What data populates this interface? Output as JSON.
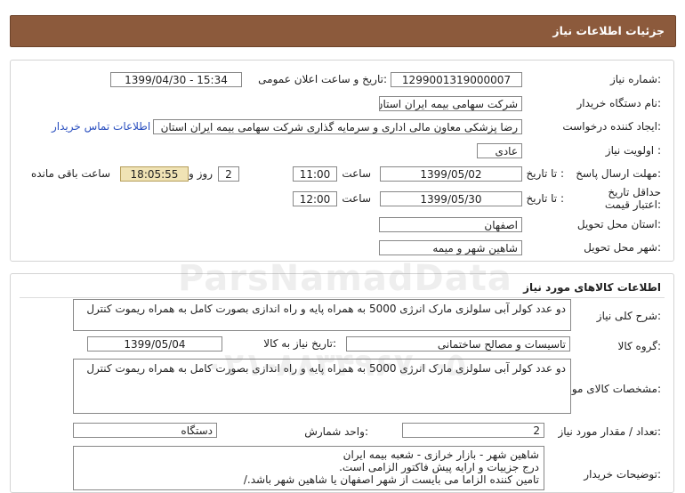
{
  "header": {
    "title": "جزئیات اطلاعات نیاز"
  },
  "info": {
    "need_number_label": "شماره نیاز:",
    "need_number": "1299001319000007",
    "announce_label": "تاریخ و ساعت اعلان عمومی:",
    "announce_value": "1399/04/30 - 15:34",
    "buyer_label": "نام دستگاه خریدار:",
    "buyer_value": "شرکت سهامی بیمه ایران استان اصفهان",
    "creator_label": "ایجاد کننده درخواست:",
    "creator_value": "رضا پزشکی معاون مالی اداری و سرمایه گذاری شرکت سهامی بیمه ایران استان",
    "contact_link": "اطلاعات تماس خریدار",
    "priority_label": "اولویت نیاز :",
    "priority_value": "عادی",
    "deadline_label": "مهلت ارسال پاسخ:",
    "to_date_label": "تا تاریخ :",
    "deadline_date": "1399/05/02",
    "time_label": "ساعت",
    "deadline_time": "11:00",
    "days_value": "2",
    "days_label": "روز و",
    "remaining_time": "18:05:55",
    "remaining_label": "ساعت باقی مانده",
    "validity_label": "حداقل تاریخ اعتبار قیمت:",
    "validity_date": "1399/05/30",
    "validity_time": "12:00",
    "province_label": "استان محل تحویل:",
    "province_value": "اصفهان",
    "city_label": "شهر محل تحویل:",
    "city_value": "شاهین شهر و میمه"
  },
  "goods": {
    "section_title": "اطلاعات کالاهای مورد نیاز",
    "desc_label": "شرح کلی نیاز:",
    "desc_value": "دو عدد کولر آبی سلولزی مارک انرژی 5000 به همراه پایه و راه اندازی بصورت کامل به همراه ریموت کنترل",
    "group_label": "گروه کالا:",
    "group_value": "تاسیسات و مصالح ساختمانی",
    "need_date_label": "تاریخ نیاز به کالا:",
    "need_date_value": "1399/05/04",
    "spec_label": "مشخصات کالای مورد نیاز:",
    "spec_value": "دو عدد کولر آبی سلولزی مارک انرژی 5000 به همراه پایه و راه اندازی بصورت کامل به همراه ریموت کنترل",
    "qty_label": "تعداد / مقدار مورد نیاز:",
    "qty_value": "2",
    "unit_label": "واحد شمارش:",
    "unit_value": "دستگاه",
    "notes_label": "توضیحات خریدار:",
    "notes_lines": [
      "شاهین شهر - بازار خرازی - شعبه بیمه ایران",
      "درج جزییات و ارایه پیش فاکتور الزامی است.",
      "تامین کننده الزاما می بایست از شهر اصفهان یا شاهین شهر باشد./"
    ]
  },
  "watermark": {
    "line1": "ParsNamadData",
    "line2": "۰۲۱-۸۸۳۴۹۶۷۰-۵"
  }
}
